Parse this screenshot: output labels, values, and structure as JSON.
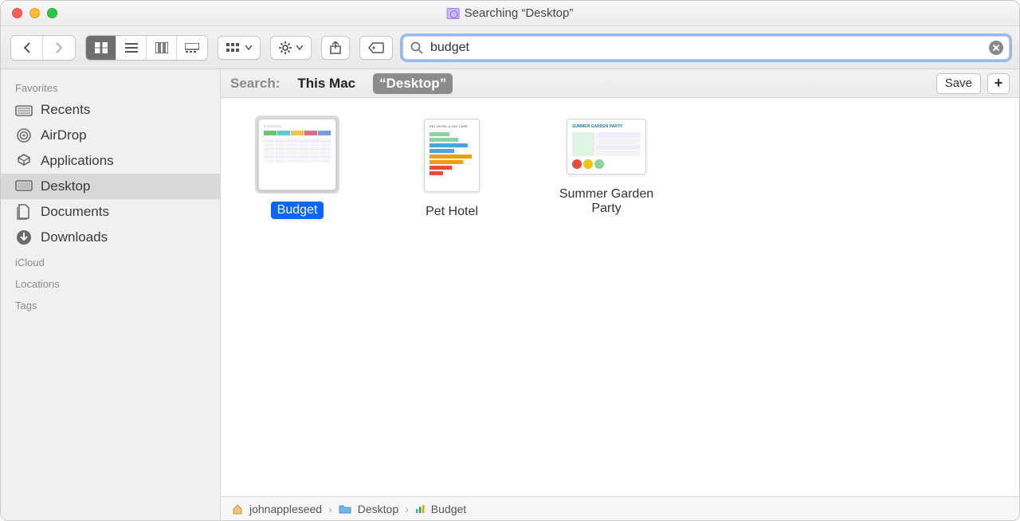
{
  "window": {
    "title": "Searching “Desktop”"
  },
  "toolbar": {
    "search_value": "budget"
  },
  "scope": {
    "label": "Search:",
    "options": [
      "This Mac",
      "“Desktop”"
    ],
    "active_index": 1,
    "save_label": "Save",
    "plus_label": "+"
  },
  "sidebar": {
    "sections": [
      {
        "header": "Favorites",
        "items": [
          {
            "label": "Recents",
            "icon": "recents-icon"
          },
          {
            "label": "AirDrop",
            "icon": "airdrop-icon"
          },
          {
            "label": "Applications",
            "icon": "applications-icon"
          },
          {
            "label": "Desktop",
            "icon": "desktop-icon",
            "selected": true
          },
          {
            "label": "Documents",
            "icon": "documents-icon"
          },
          {
            "label": "Downloads",
            "icon": "downloads-icon"
          }
        ]
      },
      {
        "header": "iCloud",
        "items": []
      },
      {
        "header": "Locations",
        "items": []
      },
      {
        "header": "Tags",
        "items": []
      }
    ]
  },
  "results": [
    {
      "name": "Budget",
      "selected": true,
      "kind": "spreadsheet"
    },
    {
      "name": "Pet Hotel",
      "selected": false,
      "kind": "document"
    },
    {
      "name": "Summer Garden Party",
      "selected": false,
      "kind": "document-wide"
    }
  ],
  "path": [
    {
      "label": "johnappleseed",
      "icon": "home-icon"
    },
    {
      "label": "Desktop",
      "icon": "folder-icon"
    },
    {
      "label": "Budget",
      "icon": "numbers-icon"
    }
  ]
}
